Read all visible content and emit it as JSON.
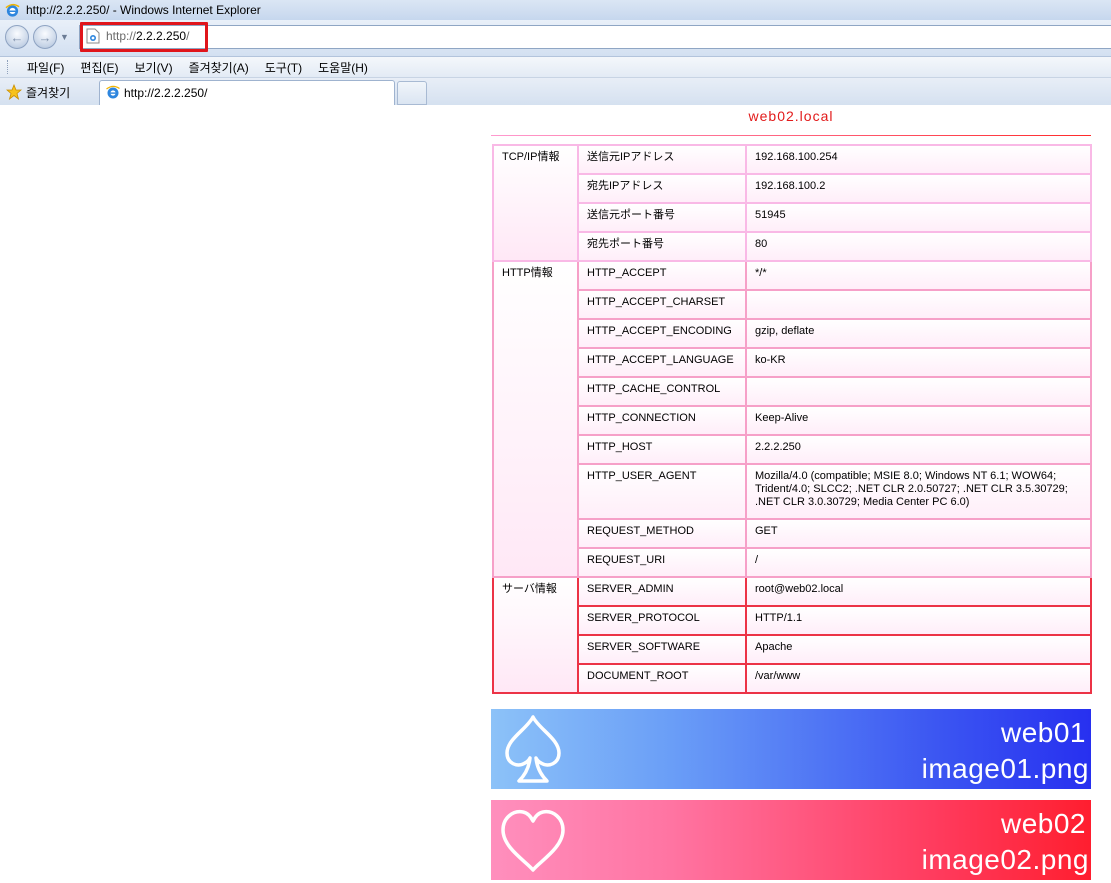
{
  "window": {
    "title": "http://2.2.2.250/ - Windows Internet Explorer"
  },
  "address": {
    "prefix": "http://",
    "host": "2.2.2.250",
    "suffix": "/"
  },
  "menu": [
    "파일(F)",
    "편집(E)",
    "보기(V)",
    "즐겨찾기(A)",
    "도구(T)",
    "도움말(H)"
  ],
  "favorites_label": "즐겨찾기",
  "tab": {
    "label": "http://2.2.2.250/"
  },
  "page": {
    "host_title": "web02.local",
    "groups": [
      {
        "name": "TCP/IP情報",
        "rows": [
          {
            "key": "送信元IPアドレス",
            "value": "192.168.100.254"
          },
          {
            "key": "宛先IPアドレス",
            "value": "192.168.100.2"
          },
          {
            "key": "送信元ポート番号",
            "value": "51945"
          },
          {
            "key": "宛先ポート番号",
            "value": "80"
          }
        ]
      },
      {
        "name": "HTTP情報",
        "rows": [
          {
            "key": "HTTP_ACCEPT",
            "value": "*/*"
          },
          {
            "key": "HTTP_ACCEPT_CHARSET",
            "value": ""
          },
          {
            "key": "HTTP_ACCEPT_ENCODING",
            "value": "gzip, deflate"
          },
          {
            "key": "HTTP_ACCEPT_LANGUAGE",
            "value": "ko-KR"
          },
          {
            "key": "HTTP_CACHE_CONTROL",
            "value": ""
          },
          {
            "key": "HTTP_CONNECTION",
            "value": "Keep-Alive"
          },
          {
            "key": "HTTP_HOST",
            "value": "2.2.2.250"
          },
          {
            "key": "HTTP_USER_AGENT",
            "value": "Mozilla/4.0 (compatible; MSIE 8.0; Windows NT 6.1; WOW64; Trident/4.0; SLCC2; .NET CLR 2.0.50727; .NET CLR 3.5.30729; .NET CLR 3.0.30729; Media Center PC 6.0)"
          },
          {
            "key": "REQUEST_METHOD",
            "value": "GET"
          },
          {
            "key": "REQUEST_URI",
            "value": "/"
          }
        ]
      },
      {
        "name": "サーバ情報",
        "rows": [
          {
            "key": "SERVER_ADMIN",
            "value": "root@web02.local"
          },
          {
            "key": "SERVER_PROTOCOL",
            "value": "HTTP/1.1"
          },
          {
            "key": "SERVER_SOFTWARE",
            "value": "Apache"
          },
          {
            "key": "DOCUMENT_ROOT",
            "value": "/var/www"
          }
        ]
      }
    ],
    "banners": [
      {
        "line1": "web01",
        "line2": "image01.png",
        "symbol": "spade-icon"
      },
      {
        "line1": "web02",
        "line2": "image02.png",
        "symbol": "heart-icon"
      }
    ]
  },
  "colors": {
    "accent_red": "#e21b1b",
    "highlight_border": "#e0151b",
    "banner1_end": "#2730f0",
    "banner2_end": "#ff1e2f"
  }
}
